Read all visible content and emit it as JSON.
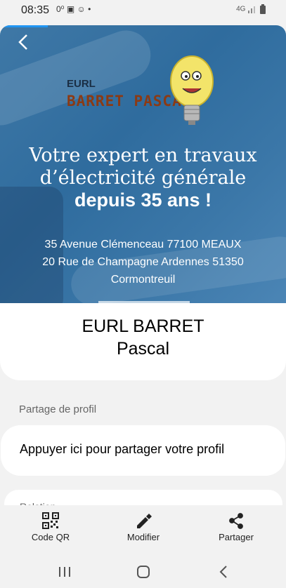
{
  "status": {
    "time": "08:35",
    "left_icons": "0⁰  ▣  ☺  •",
    "network": "4G"
  },
  "hero": {
    "logo_prefix": "EURL",
    "logo_name": "BARRET PASCAL",
    "tagline_line1": "Votre expert en travaux",
    "tagline_line2": "d’électricité générale",
    "tagline_line3": "depuis 35 ans !",
    "address_1": "35 Avenue Clémenceau 77100 MEAUX",
    "address_2": "20 Rue de Champagne Ardennes 51350",
    "address_3": "Cormontreuil"
  },
  "profile": {
    "name_line1": "EURL BARRET",
    "name_line2": "Pascal"
  },
  "share_section": {
    "title": "Partage de profil",
    "action": "Appuyer ici pour partager votre profil"
  },
  "relation_section": {
    "title": "Relation"
  },
  "bottom_tabs": [
    {
      "label": "Code QR",
      "icon": "qr-code-icon"
    },
    {
      "label": "Modifier",
      "icon": "pencil-icon"
    },
    {
      "label": "Partager",
      "icon": "share-icon"
    }
  ],
  "colors": {
    "hero_blue": "#3a73a3",
    "logo_brown": "#8b3a14",
    "accent": "#2196f3"
  }
}
